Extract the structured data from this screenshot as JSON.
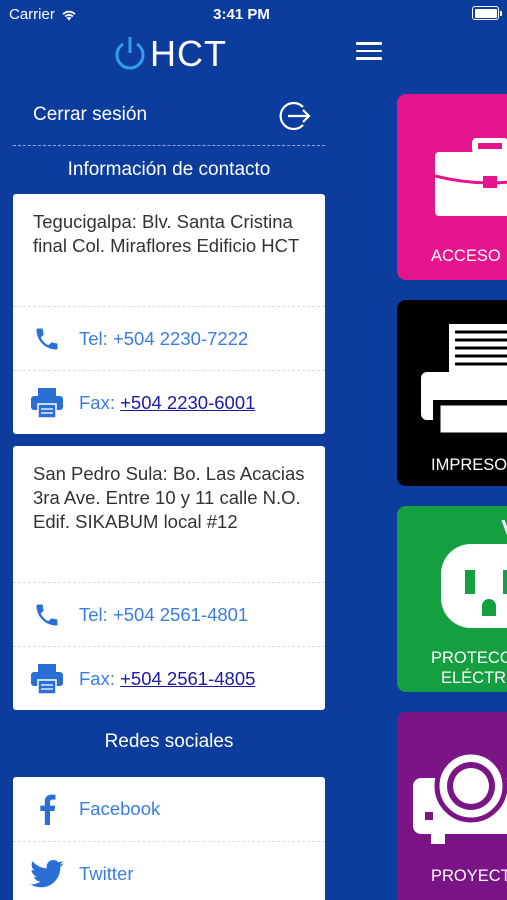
{
  "status_bar": {
    "carrier": "Carrier",
    "time": "3:41 PM"
  },
  "menu": {
    "logo_text": "HCT",
    "logout_label": "Cerrar sesión",
    "contact_title": "Información de contacto",
    "offices": [
      {
        "address": "Tegucigalpa: Blv. Santa Cristina final Col. Miraflores Edificio HCT",
        "tel_prefix": "Tel: ",
        "tel": "+504 2230-7222",
        "fax_prefix": "Fax: ",
        "fax": "+504 2230-6001"
      },
      {
        "address": "San Pedro Sula: Bo. Las Acacias 3ra Ave. Entre 10 y 11 calle N.O. Edif. SIKABUM local #12",
        "tel_prefix": "Tel: ",
        "tel": "+504 2561-4801",
        "fax_prefix": "Fax: ",
        "fax": "+504 2561-4805"
      }
    ],
    "social_title": "Redes sociales",
    "social": [
      {
        "label": "Facebook",
        "icon": "facebook-icon"
      },
      {
        "label": "Twitter",
        "icon": "twitter-icon"
      }
    ]
  },
  "content": {
    "categories": [
      {
        "label": "ACCESO",
        "color": "#e4148c",
        "icon": "briefcase-icon"
      },
      {
        "label": "IMPRESO",
        "color": "#000000",
        "icon": "printer-icon"
      },
      {
        "label": "PROTECC\nELÉCTR",
        "line1": "PROTECC",
        "line2": "ELÉCTR",
        "color": "#14a040",
        "icon": "outlet-icon"
      },
      {
        "label": "PROYECT",
        "color": "#7a1487",
        "icon": "projector-icon"
      }
    ]
  },
  "colors": {
    "background": "#0d3d9c",
    "link_blue": "#3a7de0",
    "icon_blue": "#2a6fd6"
  }
}
